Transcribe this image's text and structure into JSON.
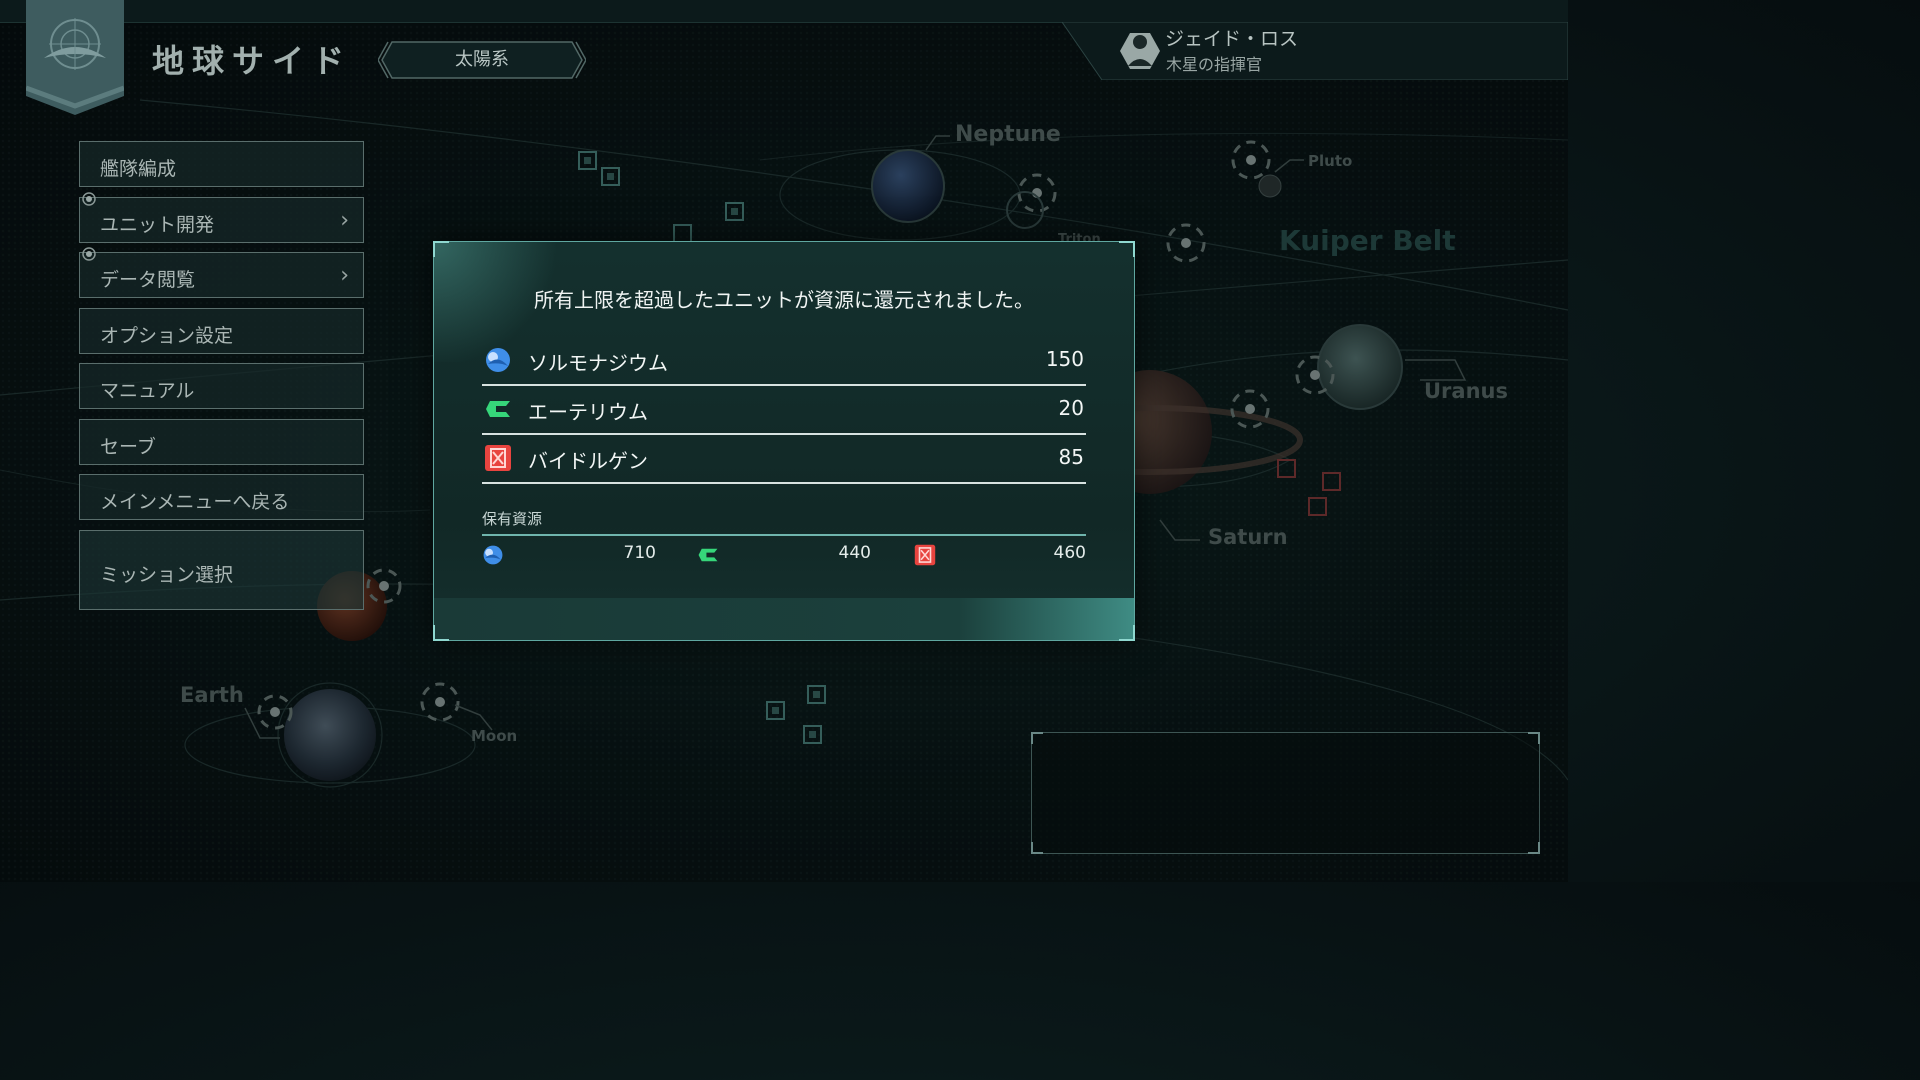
{
  "header": {
    "faction_title": "地球サイド",
    "system_name": "太陽系",
    "commander_name": "ジェイド・ロス",
    "commander_title": "木星の指揮官"
  },
  "menu": {
    "items": [
      {
        "label": "艦隊編成",
        "has_arrow": false
      },
      {
        "label": "ユニット開発",
        "has_arrow": true
      },
      {
        "label": "データ閲覧",
        "has_arrow": true
      },
      {
        "label": "オプション設定",
        "has_arrow": false
      },
      {
        "label": "マニュアル",
        "has_arrow": false
      },
      {
        "label": "セーブ",
        "has_arrow": false
      },
      {
        "label": "メインメニューへ戻る",
        "has_arrow": false
      },
      {
        "label": "ミッション選択",
        "has_arrow": false
      }
    ]
  },
  "map_labels": {
    "neptune": "Neptune",
    "pluto": "Pluto",
    "triton": "Triton",
    "kuiper_belt": "Kuiper Belt",
    "uranus": "Uranus",
    "saturn": "Saturn",
    "earth": "Earth",
    "moon": "Moon"
  },
  "dialog": {
    "message": "所有上限を超過したユニットが資源に還元されました。",
    "resources": [
      {
        "name": "ソルモナジウム",
        "value": "150",
        "icon": "solmonadium-icon",
        "color": "#3f8ee8"
      },
      {
        "name": "エーテリウム",
        "value": "20",
        "icon": "etherium-icon",
        "color": "#36d67a"
      },
      {
        "name": "バイドルゲン",
        "value": "85",
        "icon": "baidorgen-icon",
        "color": "#e8443f"
      }
    ],
    "holdings_label": "保有資源",
    "holdings": [
      {
        "icon": "solmonadium-icon",
        "value": "710"
      },
      {
        "icon": "etherium-icon",
        "value": "440"
      },
      {
        "icon": "baidorgen-icon",
        "value": "460"
      }
    ]
  },
  "colors": {
    "accent": "#5fa7a0",
    "dialog_bg": "#13302e",
    "solmonadium": "#3f8ee8",
    "etherium": "#36d67a",
    "baidorgen": "#e8443f"
  }
}
